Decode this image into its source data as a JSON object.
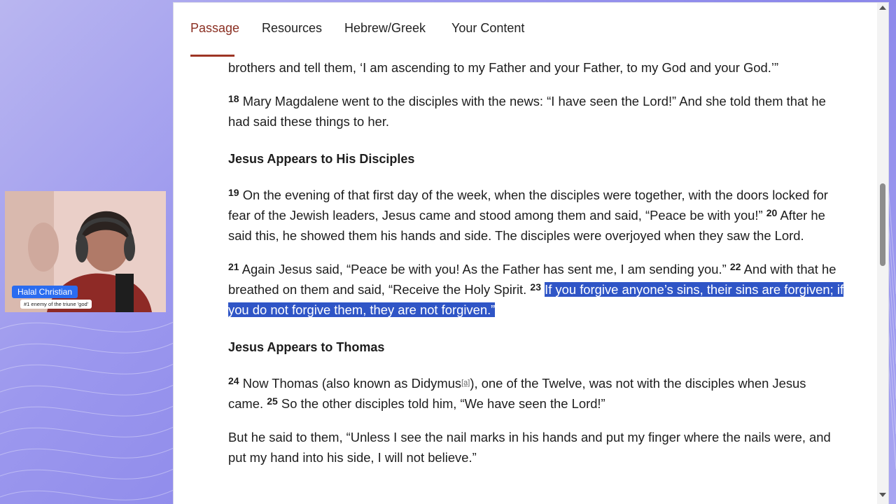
{
  "tabs": [
    {
      "label": "Passage",
      "active": true
    },
    {
      "label": "Resources",
      "active": false
    },
    {
      "label": "Hebrew/Greek",
      "active": false
    },
    {
      "label": "Your Content",
      "active": false
    }
  ],
  "passage": {
    "line_top": "brothers and tell them, ‘I am ascending to my Father and your Father, to my God and your God.’”",
    "v18_num": "18",
    "v18_text": "Mary Magdalene went to the disciples with the news: “I have seen the Lord!” And she told them that he had said these things to her.",
    "heading1": "Jesus Appears to His Disciples",
    "v19_num": "19",
    "v19_text": "On the evening of that first day of the week, when the disciples were together, with the doors locked for fear of the Jewish leaders, Jesus came and stood among them and said, “Peace be with you!”",
    "v20_num": "20",
    "v20_text": "After he said this, he showed them his hands and side. The disciples were overjoyed when they saw the Lord.",
    "v21_num": "21",
    "v21_text": "Again Jesus said, “Peace be with you! As the Father has sent me, I am sending you.”",
    "v22_num": "22",
    "v22_text": "And with that he breathed on them and said, “Receive the Holy Spirit.",
    "v23_num": "23",
    "v23_text": "If you forgive anyone’s sins, their sins are forgiven; if you do not forgive them, they are not forgiven.”",
    "heading2": "Jesus Appears to Thomas",
    "v24_num": "24",
    "v24_text_a": "Now Thomas (also known as Didymus",
    "v24_footnote": "[a]",
    "v24_text_b": "), one of the Twelve, was not with the disciples when Jesus came.",
    "v25_num": "25",
    "v25_text": "So the other disciples told him, “We have seen the Lord!”",
    "para_last": "But he said to them, “Unless I see the nail marks in his hands and put my finger where the nails were, and put my hand into his side, I will not believe.”"
  },
  "webcam": {
    "name": "Halal Christian",
    "tagline": "#1 enemy of the triune 'god'"
  },
  "colors": {
    "active_tab": "#8a2f22",
    "highlight": "#2f55c6",
    "name_tag": "#2a6cf0"
  }
}
